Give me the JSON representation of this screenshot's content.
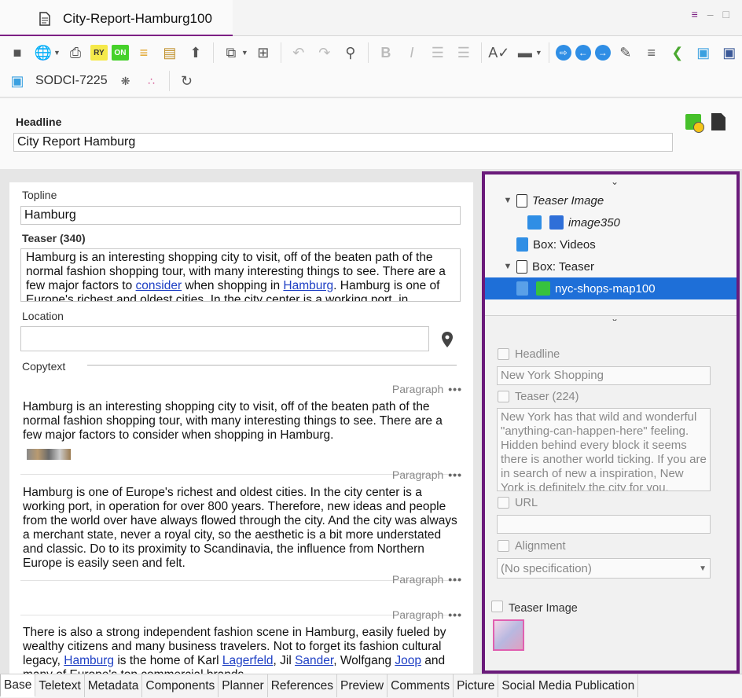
{
  "window": {
    "title": "City-Report-Hamburg100",
    "controls": [
      "≡",
      "–",
      "□"
    ]
  },
  "toolbar": {
    "ry_label": "RY",
    "on_label": "ON",
    "doc_id": "SODCI-7225"
  },
  "headline": {
    "label": "Headline",
    "value": "City Report Hamburg"
  },
  "left": {
    "topline_label": "Topline",
    "topline_value": "Hamburg",
    "teaser_label": "Teaser (340)",
    "teaser_part1": "Hamburg is an interesting shopping city to visit, off of the beaten path of the normal fashion shopping tour, with many interesting things to see. There are a few major factors to ",
    "teaser_link1": "consider",
    "teaser_part2": " when shopping in ",
    "teaser_link2": "Hamburg",
    "teaser_part3": ". Hamburg is one of Europe's richest and oldest cities. In the city center is a working port, in",
    "location_label": "Location",
    "location_value": "",
    "copytext_label": "Copytext",
    "paragraph_tag": "Paragraph",
    "dots": "•••",
    "para1": "Hamburg is an interesting shopping city to visit, off of the beaten path of the normal fashion shopping tour, with many interesting things to see. There are a few major factors to consider when shopping in Hamburg.",
    "para2": "Hamburg is one of Europe's richest and oldest cities. In the city center is a working port, in operation for over 800 years. Therefore, new ideas and people from the world over have always flowed through the city. And the city was always a merchant state, never a royal city, so the aesthetic is a bit more understated and classic. Do to its proximity to Scandinavia, the influence from Northern Europe is easily seen and felt.",
    "para4_a": "There is also a strong independent fashion scene in Hamburg, easily fueled by wealthy citizens and many business travelers. Not to forget its fashion cultural legacy, ",
    "para4_l1": "Hamburg",
    "para4_b": " is the home of Karl ",
    "para4_l2": "Lagerfeld",
    "para4_c": ", Jil ",
    "para4_l3": "Sander",
    "para4_d": ", Wolfgang ",
    "para4_l4": "Joop",
    "para4_e": " and many of Europe's top commercial brands."
  },
  "tree": {
    "items": [
      {
        "label": "Teaser Image"
      },
      {
        "label": "image350"
      },
      {
        "label": "Box: Videos"
      },
      {
        "label": "Box: Teaser"
      },
      {
        "label": "nyc-shops-map100"
      }
    ]
  },
  "props": {
    "headline_label": "Headline",
    "headline_value": "New York Shopping",
    "teaser_label": "Teaser (224)",
    "teaser_value": "New York has that wild and wonderful \"anything-can-happen-here\" feeling. Hidden behind every block it seems there is another world ticking.  If you are in search of new a inspiration, New York is definitely the city for you.",
    "url_label": "URL",
    "url_value": "",
    "alignment_label": "Alignment",
    "alignment_value": "(No specification)",
    "teaser_image_label": "Teaser Image"
  },
  "tabs": [
    "Base",
    "Teletext",
    "Metadata",
    "Components",
    "Planner",
    "References",
    "Preview",
    "Comments",
    "Picture",
    "Social Media Publication"
  ]
}
